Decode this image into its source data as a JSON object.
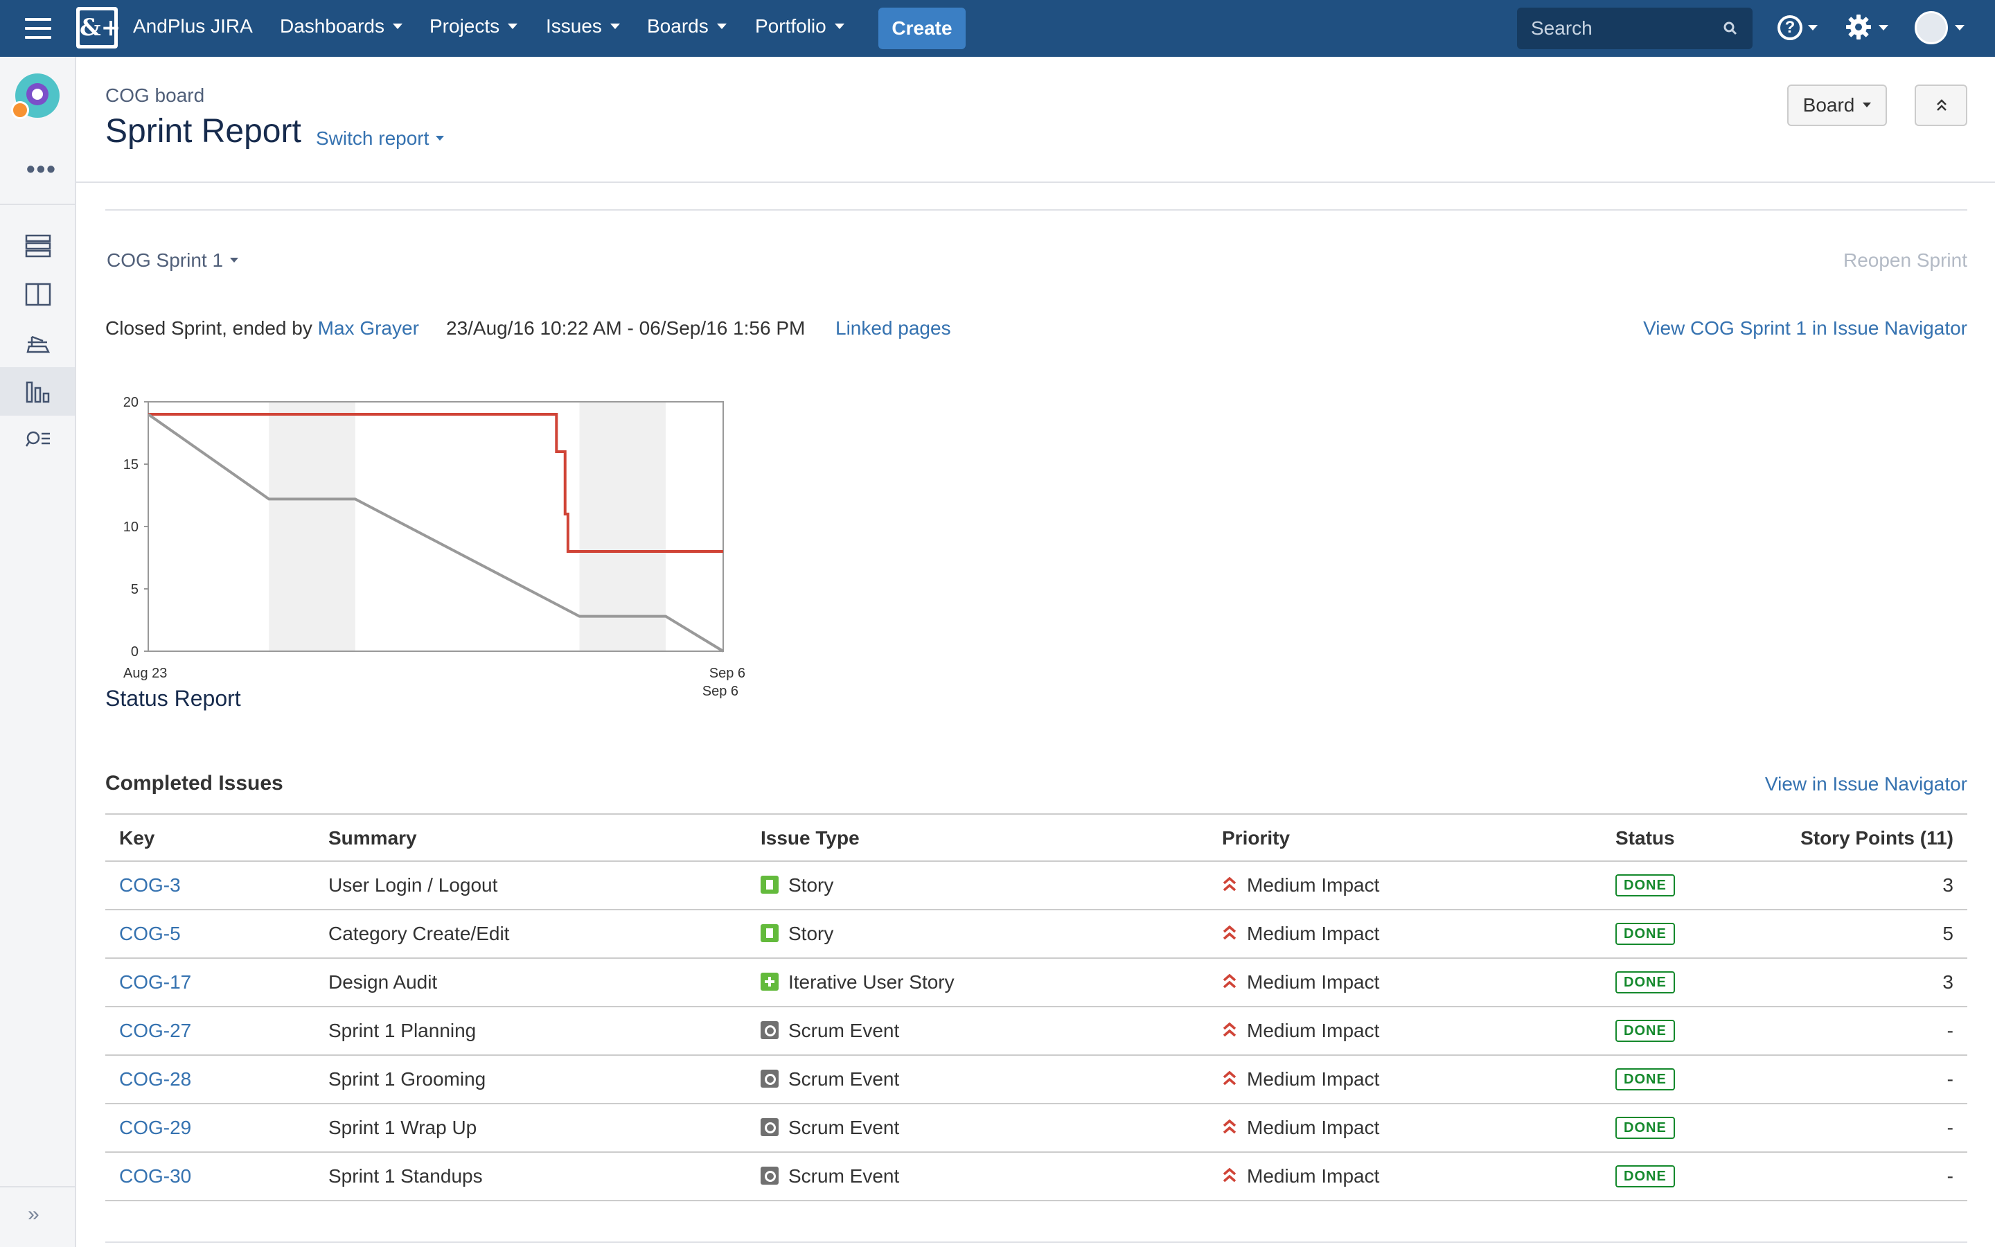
{
  "topnav": {
    "brand": "AndPlus JIRA",
    "logo_text": "&+",
    "menu": [
      "Dashboards",
      "Projects",
      "Issues",
      "Boards",
      "Portfolio"
    ],
    "create_label": "Create",
    "search_placeholder": "Search",
    "help_glyph": "?"
  },
  "sidebar": {
    "more_label": "•••",
    "expand_label": "»",
    "items": [
      "backlog-icon",
      "active-sprints-icon",
      "releases-icon",
      "reports-icon",
      "issues-search-icon"
    ],
    "active": "reports-icon"
  },
  "header": {
    "breadcrumb": "COG board",
    "title": "Sprint Report",
    "switch_report": "Switch report",
    "board_button": "Board"
  },
  "sprint": {
    "name": "COG Sprint 1",
    "reopen": "Reopen Sprint",
    "closed_prefix": "Closed Sprint, ended by",
    "ended_by": "Max Grayer",
    "dates": "23/Aug/16 10:22 AM - 06/Sep/16 1:56 PM",
    "linked_pages": "Linked pages",
    "view_navigator": "View COG Sprint 1 in Issue Navigator"
  },
  "chart_data": {
    "type": "line",
    "title": "",
    "xlabel": "",
    "ylabel": "",
    "ylim": [
      0,
      20
    ],
    "yticks": [
      0,
      5,
      10,
      15,
      20
    ],
    "x_ticks": [
      "Aug 23",
      "Sep 6"
    ],
    "x_tick_sub": "Sep 6",
    "xlim_days": [
      0,
      14
    ],
    "non_working_bands": [
      [
        2.1,
        3.6
      ],
      [
        7.5,
        9.0
      ]
    ],
    "series": [
      {
        "color": "#d04437",
        "points": [
          [
            0,
            19
          ],
          [
            7.1,
            19
          ],
          [
            7.1,
            16
          ],
          [
            7.25,
            16
          ],
          [
            7.25,
            11
          ],
          [
            7.3,
            11
          ],
          [
            7.3,
            8
          ],
          [
            10.0,
            8
          ]
        ]
      },
      {
        "color": "#999999",
        "points": [
          [
            0,
            19
          ],
          [
            2.1,
            12.2
          ],
          [
            3.6,
            12.2
          ],
          [
            7.5,
            2.8
          ],
          [
            9.0,
            2.8
          ],
          [
            10.0,
            0
          ]
        ]
      }
    ],
    "grid": false
  },
  "status_report": "Status Report",
  "completed": {
    "title": "Completed Issues",
    "view_navigator": "View in Issue Navigator",
    "columns": [
      "Key",
      "Summary",
      "Issue Type",
      "Priority",
      "Status",
      "Story Points (11)"
    ],
    "rows": [
      {
        "key": "COG-3",
        "summary": "User Login / Logout",
        "type": "Story",
        "type_icon": "story-icon",
        "priority": "Medium Impact",
        "status": "DONE",
        "points": "3"
      },
      {
        "key": "COG-5",
        "summary": "Category Create/Edit",
        "type": "Story",
        "type_icon": "story-icon",
        "priority": "Medium Impact",
        "status": "DONE",
        "points": "5"
      },
      {
        "key": "COG-17",
        "summary": "Design Audit",
        "type": "Iterative User Story",
        "type_icon": "iterative-story-icon",
        "priority": "Medium Impact",
        "status": "DONE",
        "points": "3"
      },
      {
        "key": "COG-27",
        "summary": "Sprint 1 Planning",
        "type": "Scrum Event",
        "type_icon": "scrum-event-icon",
        "priority": "Medium Impact",
        "status": "DONE",
        "points": "-"
      },
      {
        "key": "COG-28",
        "summary": "Sprint 1 Grooming",
        "type": "Scrum Event",
        "type_icon": "scrum-event-icon",
        "priority": "Medium Impact",
        "status": "DONE",
        "points": "-"
      },
      {
        "key": "COG-29",
        "summary": "Sprint 1 Wrap Up",
        "type": "Scrum Event",
        "type_icon": "scrum-event-icon",
        "priority": "Medium Impact",
        "status": "DONE",
        "points": "-"
      },
      {
        "key": "COG-30",
        "summary": "Sprint 1 Standups",
        "type": "Scrum Event",
        "type_icon": "scrum-event-icon",
        "priority": "Medium Impact",
        "status": "DONE",
        "points": "-"
      }
    ]
  }
}
